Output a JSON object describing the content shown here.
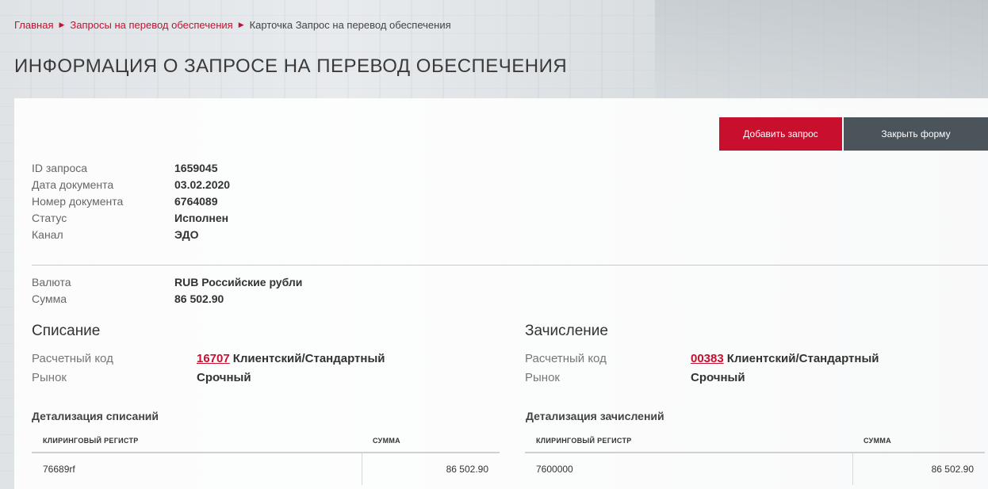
{
  "breadcrumb": {
    "home": "Главная",
    "requests": "Запросы на перевод обеспечения",
    "current": "Карточка Запрос на перевод обеспечения"
  },
  "page_title": "ИНФОРМАЦИЯ О ЗАПРОСЕ НА ПЕРЕВОД ОБЕСПЕЧЕНИЯ",
  "buttons": {
    "add_request": "Добавить запрос",
    "close_form": "Закрыть форму"
  },
  "info": [
    {
      "label": "ID запроса",
      "value": "1659045"
    },
    {
      "label": "Дата документа",
      "value": "03.02.2020"
    },
    {
      "label": "Номер документа",
      "value": "6764089"
    },
    {
      "label": "Статус",
      "value": "Исполнен"
    },
    {
      "label": "Канал",
      "value": "ЭДО"
    }
  ],
  "money": [
    {
      "label": "Валюта",
      "value": "RUB Российские рубли"
    },
    {
      "label": "Сумма",
      "value": "86 502.90"
    }
  ],
  "debit": {
    "title": "Списание",
    "code_label": "Расчетный код",
    "code": "16707",
    "code_desc": "Клиентский/Стандартный",
    "market_label": "Рынок",
    "market": "Срочный",
    "detail_title": "Детализация списаний",
    "columns": [
      "КЛИРИНГОВЫЙ РЕГИСТР",
      "СУММА"
    ],
    "rows": [
      {
        "register": "76689rf",
        "amount": "86 502.90"
      }
    ]
  },
  "credit": {
    "title": "Зачисление",
    "code_label": "Расчетный код",
    "code": "00383",
    "code_desc": "Клиентский/Стандартный",
    "market_label": "Рынок",
    "market": "Срочный",
    "detail_title": "Детализация зачислений",
    "columns": [
      "КЛИРИНГОВЫЙ РЕГИСТР",
      "СУММА"
    ],
    "rows": [
      {
        "register": "7600000",
        "amount": "86 502.90"
      }
    ]
  },
  "colors": {
    "accent": "#c8102e",
    "secondary_button": "#4b545b"
  }
}
